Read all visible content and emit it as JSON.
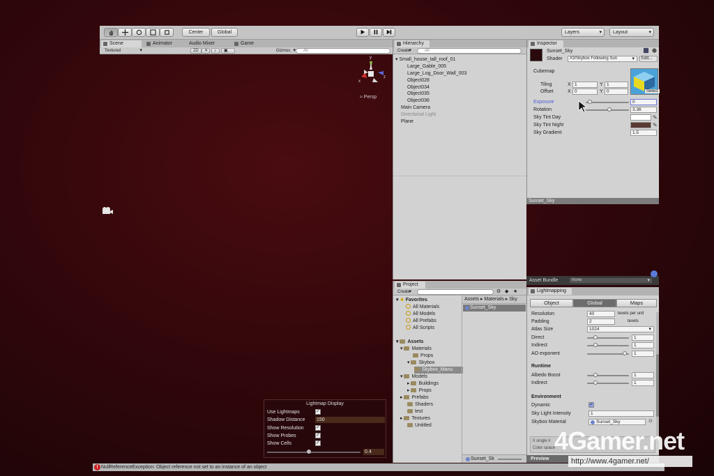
{
  "toolbar": {
    "pivot": "Center",
    "space": "Global",
    "layers": "Layers",
    "layout": "Layout"
  },
  "scene": {
    "tabs": [
      {
        "label": "Scene"
      },
      {
        "label": "Animator"
      },
      {
        "label": "Audio Mixer"
      },
      {
        "label": "Game"
      }
    ],
    "shading": "Textured",
    "mode_2d": "2D",
    "gizmos": "Gizmos",
    "search_placeholder": "All",
    "persp_label": "Persp",
    "gizmo_axes": {
      "x": "x",
      "y": "y",
      "z": "z"
    }
  },
  "hierarchy": {
    "title": "Hierarchy",
    "create": "Create",
    "search_placeholder": "All",
    "items": [
      {
        "label": "Small_house_tall_roof_01"
      },
      {
        "label": "Large_Gable_005"
      },
      {
        "label": "Large_Log_Door_Wall_003"
      },
      {
        "label": "Object028"
      },
      {
        "label": "Object034"
      },
      {
        "label": "Object035"
      },
      {
        "label": "Object036"
      },
      {
        "label": "Main Camera"
      },
      {
        "label": "Directional Light"
      },
      {
        "label": "Plane"
      }
    ]
  },
  "inspector": {
    "title": "Inspector",
    "material_name": "Sunset_Sky",
    "shader_label": "Shader",
    "shader_value": "X3/Skybox Following Sun",
    "edit": "Edit...",
    "cubemap_label": "Cubemap",
    "tiling_label": "Tiling",
    "offset_label": "Offset",
    "tiling_x": "1",
    "tiling_y": "1",
    "offset_x": "0",
    "offset_y": "0",
    "axis_x": "X",
    "axis_y": "Y",
    "select": "Select",
    "exposure_label": "Exposure",
    "exposure_value": "0",
    "rotation_label": "Rotation",
    "rotation_value": "3.36",
    "sky_tint_day_label": "Sky Tint Day",
    "sky_tint_night_label": "Sky Tint Night",
    "sky_gradient_label": "Sky Gradient",
    "sky_gradient_value": "1.5",
    "preview_label": "Sunset_Sky",
    "exposure_slider": 0.1,
    "rotation_slider": 0.55
  },
  "project": {
    "title": "Project",
    "create": "Create",
    "favorites_label": "Favorites",
    "favorites": [
      {
        "label": "All Materials"
      },
      {
        "label": "All Models"
      },
      {
        "label": "All Prefabs"
      },
      {
        "label": "All Scripts"
      }
    ],
    "assets_label": "Assets",
    "tree": [
      {
        "label": "Materials"
      },
      {
        "label": "Props"
      },
      {
        "label": "Skybox"
      },
      {
        "label": "Skybox_Manu"
      },
      {
        "label": "Models"
      },
      {
        "label": "Buildings"
      },
      {
        "label": "Props"
      },
      {
        "label": "Prefabs"
      },
      {
        "label": "Shaders"
      },
      {
        "label": "test"
      },
      {
        "label": "Textures"
      },
      {
        "label": "Untitled"
      }
    ],
    "breadcrumb": [
      "Assets",
      "Materials",
      "Sky"
    ],
    "file": "Sunset_Sky",
    "footer_file": "Sunset_Sk"
  },
  "asset_bundle": {
    "label": "Asset Bundle",
    "value": "None"
  },
  "lightmapping": {
    "title": "Lightmapping",
    "tabs": [
      "Object",
      "Global",
      "Maps"
    ],
    "active_tab": "Global",
    "resolution_label": "Resolution",
    "resolution_value": "40",
    "resolution_unit": "texels per unit",
    "padding_label": "Padding",
    "padding_value": "2",
    "padding_unit": "texels",
    "atlas_label": "Atlas Size",
    "atlas_value": "1024",
    "direct_label": "Direct",
    "direct_value": "1",
    "indirect_label": "Indirect",
    "indirect_value": "1",
    "ao_label": "AO exponent",
    "ao_value": "1",
    "runtime_label": "Runtime",
    "albedo_label": "Albedo Boost",
    "albedo_value": "1",
    "runtime_indirect_label": "Indirect",
    "runtime_indirect_value": "1",
    "environment_label": "Environment",
    "dynamic_label": "Dynamic",
    "sky_intensity_label": "Sky Light Intensity",
    "sky_intensity_value": "1",
    "skybox_material_label": "Skybox Material",
    "skybox_material_value": "Sunset_Sky",
    "single_lightmap": "0 single li",
    "color_space": "Color space",
    "preview": "Preview",
    "direct_slider": 0.2,
    "indirect_slider": 0.2,
    "ao_slider": 0.9,
    "albedo_slider": 0.2,
    "runtime_indirect_slider": 0.2
  },
  "lightmap_display": {
    "title": "Lightmap Display",
    "rows": [
      {
        "label": "Use Lightmaps"
      },
      {
        "label": "Shadow Distance"
      },
      {
        "label": "Show Resolution"
      },
      {
        "label": "Show Probes"
      },
      {
        "label": "Show Cells"
      }
    ],
    "shadow_distance": "150",
    "slider_value": "0.4",
    "slider_fraction": 0.45
  },
  "status": {
    "message": "NullReferenceException: Object reference not set to an instance of an object"
  },
  "watermark": {
    "logo": "4Gamer.net",
    "url": "http://www.4gamer.net/"
  },
  "colors": {
    "background": "#32070b",
    "panel": "#d2d2d2",
    "selection": "#6c6c6c",
    "error": "#c82020"
  }
}
